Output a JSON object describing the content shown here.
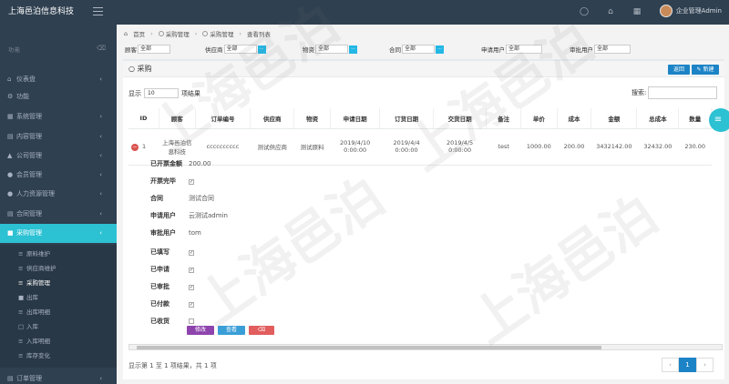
{
  "app": {
    "brand": "上海邑泊信息科技",
    "user": "企业管理Admin"
  },
  "sidebar": {
    "section_label": "功能",
    "items": [
      {
        "label": "仪表盘",
        "icon": "home-icon"
      },
      {
        "label": "功能",
        "icon": "gear-icon"
      },
      {
        "label": "系统管理",
        "icon": "grid-icon"
      },
      {
        "label": "内容管理",
        "icon": "doc-icon"
      },
      {
        "label": "公司管理",
        "icon": "building-icon"
      },
      {
        "label": "会员管理",
        "icon": "user-icon"
      },
      {
        "label": "人力资源管理",
        "icon": "people-icon"
      },
      {
        "label": "合同管理",
        "icon": "contract-icon"
      },
      {
        "label": "采购管理",
        "icon": "cart-icon"
      }
    ],
    "subitems": [
      "原料维护",
      "供应商维护",
      "采购管理",
      "出库",
      "出库明细",
      "入库",
      "入库明细",
      "库存变化"
    ],
    "bottom_item": "订单管理"
  },
  "breadcrumb": [
    "首页",
    "采购管理",
    "采购管理",
    "查看列表"
  ],
  "filters": {
    "customer_label": "顾客",
    "customer_value": "全部",
    "supplier_label": "供应商",
    "supplier_value": "全部",
    "material_label": "物资",
    "material_value": "全部",
    "contract_label": "合同",
    "contract_value": "全部",
    "applicant_label": "申请用户",
    "applicant_value": "全部",
    "approver_label": "审批用户",
    "approver_value": "全部",
    "dots": "..."
  },
  "panel": {
    "title": "采购",
    "back_label": "返回",
    "new_label": "新建"
  },
  "table_controls": {
    "show_label": "显示",
    "page_size": "10",
    "entries_label": "项结果",
    "search_label": "搜索:"
  },
  "table": {
    "headers": [
      "ID",
      "顾客",
      "订单编号",
      "供应商",
      "物资",
      "申请日期",
      "订货日期",
      "交货日期",
      "备注",
      "单价",
      "成本",
      "金额",
      "总成本",
      "数量"
    ],
    "row": {
      "id": "1",
      "customer": "上海邑泊信息科技",
      "order_no": "cccccccccc",
      "supplier": "测试供应商",
      "material": "测试原料",
      "apply_date": "2019/4/10 0:00:00",
      "order_date": "2019/4/4 0:00:00",
      "delivery_date": "2019/4/5 0:00:00",
      "remark": "test",
      "unit_price": "1000.00",
      "cost": "200.00",
      "amount": "3432142.00",
      "total_cost": "32432.00",
      "quantity": "230.00"
    }
  },
  "details": [
    {
      "label": "已开票金额",
      "value": "200.00",
      "type": "text"
    },
    {
      "label": "开票完毕",
      "value": "✓",
      "type": "check"
    },
    {
      "label": "合同",
      "value": "测试合同",
      "type": "text"
    },
    {
      "label": "申请用户",
      "value": "云测试admin",
      "type": "text"
    },
    {
      "label": "审批用户",
      "value": "tom",
      "type": "text"
    },
    {
      "label": "已填写",
      "value": "✓",
      "type": "check"
    },
    {
      "label": "已申请",
      "value": "✓",
      "type": "check"
    },
    {
      "label": "已审批",
      "value": "✓",
      "type": "check"
    },
    {
      "label": "已付款",
      "value": "✓",
      "type": "check"
    },
    {
      "label": "已收货",
      "value": "",
      "type": "check"
    }
  ],
  "actions": {
    "edit": "修改",
    "view": "查看",
    "delete": "删除"
  },
  "footer": {
    "summary": "显示第 1 至 1 项结果，共 1 项",
    "prev": "‹",
    "page": "1",
    "next": "›"
  },
  "watermark": "上海邑泊"
}
